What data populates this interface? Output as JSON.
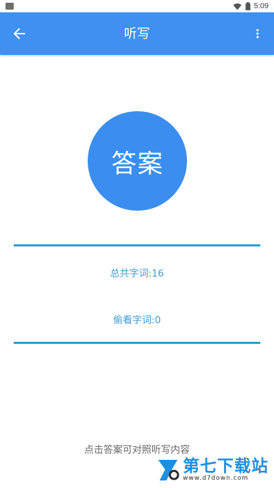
{
  "status_bar": {
    "time": "5:09",
    "icons": [
      "wifi-icon",
      "battery-icon"
    ]
  },
  "app_bar": {
    "title": "听写",
    "back_icon": "arrow-left-icon",
    "more_icon": "more-vertical-icon",
    "color": "#3f90f0"
  },
  "answer_button": {
    "label": "答案",
    "color": "#3b8ef0"
  },
  "stats": {
    "total_words": "总共字词:16",
    "peeked_words": "偷看字词:0"
  },
  "divider_color": "#1f9ed4",
  "hint": "点击答案可对照听写内容",
  "watermark": {
    "title": "第七下载站",
    "url": "www.d7down.com"
  }
}
